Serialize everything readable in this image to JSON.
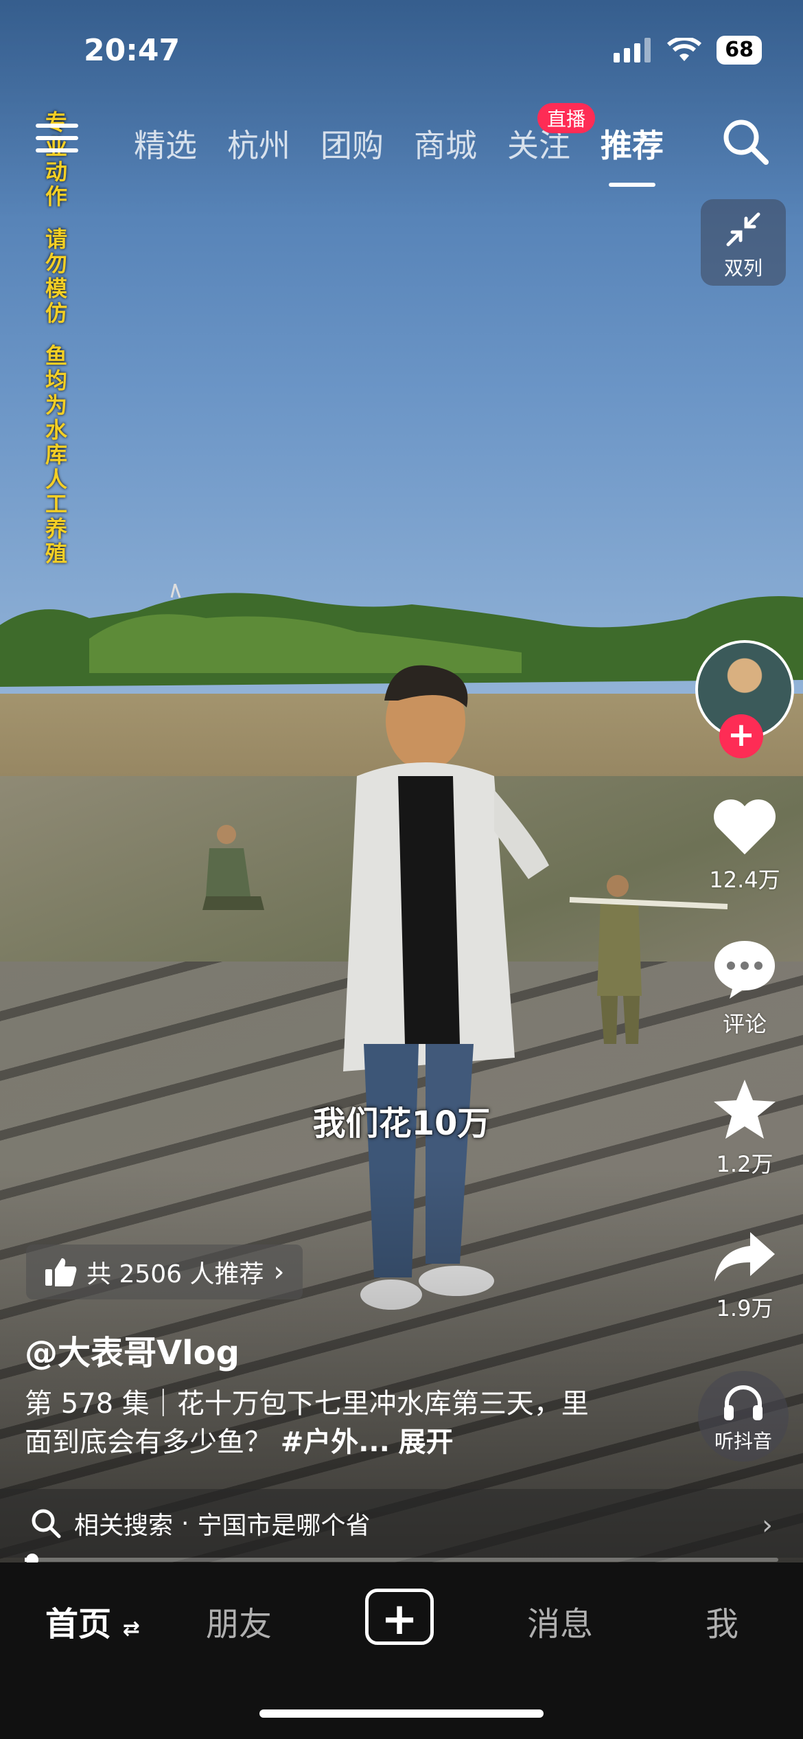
{
  "status": {
    "time": "20:47",
    "battery": "68"
  },
  "side_notice": [
    "专业动作",
    "请勿模仿",
    "鱼均为水库人工养殖"
  ],
  "top_tabs": [
    {
      "label": "精选"
    },
    {
      "label": "杭州"
    },
    {
      "label": "团购"
    },
    {
      "label": "商城"
    },
    {
      "label": "关注",
      "badge": "直播"
    },
    {
      "label": "推荐",
      "active": true
    }
  ],
  "right_rail": {
    "dual_column_label": "双列",
    "likes": "12.4万",
    "comments_label": "评论",
    "favorites": "1.2万",
    "shares": "1.9万",
    "listen_label": "听抖音"
  },
  "video": {
    "subtitle": "我们花10万",
    "recommend_text": "共 2506 人推荐",
    "username": "@大表哥Vlog",
    "description": "第 578 集｜花十万包下七里冲水库第三天，里面到底会有多少鱼？",
    "hashtag": "#户外...",
    "expand_label": "展开",
    "progress_fraction": 0.01
  },
  "related_search": {
    "prefix": "相关搜索",
    "query": "宁国市是哪个省"
  },
  "bottom_tabs": {
    "home": "首页",
    "friends": "朋友",
    "messages": "消息",
    "me": "我"
  },
  "colors": {
    "accent": "#fe2c55",
    "notice_yellow": "#f4cf25"
  }
}
